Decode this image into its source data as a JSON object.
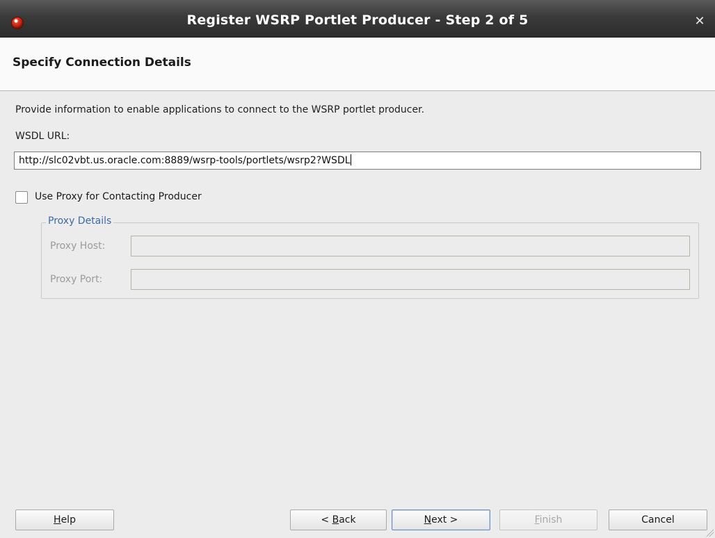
{
  "window": {
    "title": "Register WSRP Portlet Producer - Step 2 of 5",
    "close_icon": "close-icon",
    "app_icon": "oracle-jdeveloper-icon"
  },
  "header": {
    "title": "Specify Connection Details"
  },
  "main": {
    "description": "Provide information to enable applications to connect to the WSRP portlet producer.",
    "wsdl_label": "WSDL URL:",
    "wsdl_value": "http://slc02vbt.us.oracle.com:8889/wsrp-tools/portlets/wsrp2?WSDL",
    "use_proxy": {
      "label": "Use Proxy for Contacting Producer",
      "checked": false
    },
    "proxy_details": {
      "legend": "Proxy Details",
      "host_label": "Proxy Host:",
      "host_value": "",
      "port_label": "Proxy Port:",
      "port_value": ""
    }
  },
  "buttons": {
    "help": {
      "mnemonic": "H",
      "rest": "elp"
    },
    "back": {
      "prefix": "< ",
      "mnemonic": "B",
      "rest": "ack"
    },
    "next": {
      "mnemonic": "N",
      "rest": "ext >"
    },
    "finish": {
      "mnemonic": "F",
      "rest": "inish",
      "disabled": true
    },
    "cancel": {
      "label": "Cancel"
    }
  },
  "colors": {
    "titlebar": "#3a3a3a",
    "legend_text": "#3e6aa3",
    "default_button_border": "#6a8dbd"
  }
}
